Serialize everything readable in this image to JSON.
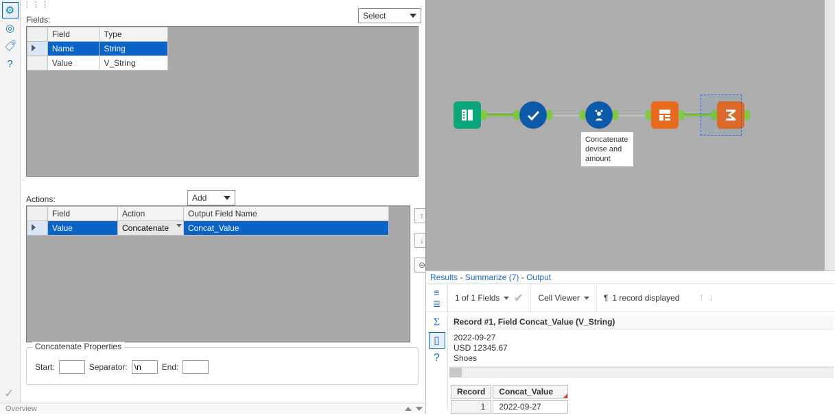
{
  "select_button": "Select",
  "fields": {
    "label": "Fields:",
    "columns": [
      "Field",
      "Type"
    ],
    "rows": [
      {
        "field": "Name",
        "type": "String",
        "selected": true
      },
      {
        "field": "Value",
        "type": "V_String",
        "selected": false
      }
    ]
  },
  "actions": {
    "label": "Actions:",
    "add_button": "Add",
    "columns": [
      "Field",
      "Action",
      "Output Field Name"
    ],
    "rows": [
      {
        "field": "Value",
        "action": "Concatenate",
        "output": "Concat_Value",
        "selected": true
      }
    ]
  },
  "concat": {
    "legend": "Concatenate Properties",
    "start_label": "Start:",
    "start_value": "",
    "separator_label": "Separator:",
    "separator_value": "\\n",
    "end_label": "End:",
    "end_value": ""
  },
  "overview_label": "Overview",
  "canvas": {
    "annotation": "Concatenate devise and amount",
    "nodes": [
      "Input Data",
      "Select",
      "Formula",
      "Transpose",
      "Summarize"
    ]
  },
  "results": {
    "title_parts": [
      "Results",
      "Summarize (7)",
      "Output"
    ],
    "fields_count": "1 of 1 Fields",
    "cell_viewer_label": "Cell Viewer",
    "record_count": "1 record displayed",
    "record_title": "Record #1, Field Concat_Value (V_String)",
    "record_lines": [
      "2022-09-27",
      "USD 12345.67",
      "Shoes"
    ],
    "grid": {
      "columns": [
        "Record",
        "Concat_Value"
      ],
      "rows": [
        {
          "record": "1",
          "concat_value": "2022-09-27"
        }
      ]
    }
  }
}
